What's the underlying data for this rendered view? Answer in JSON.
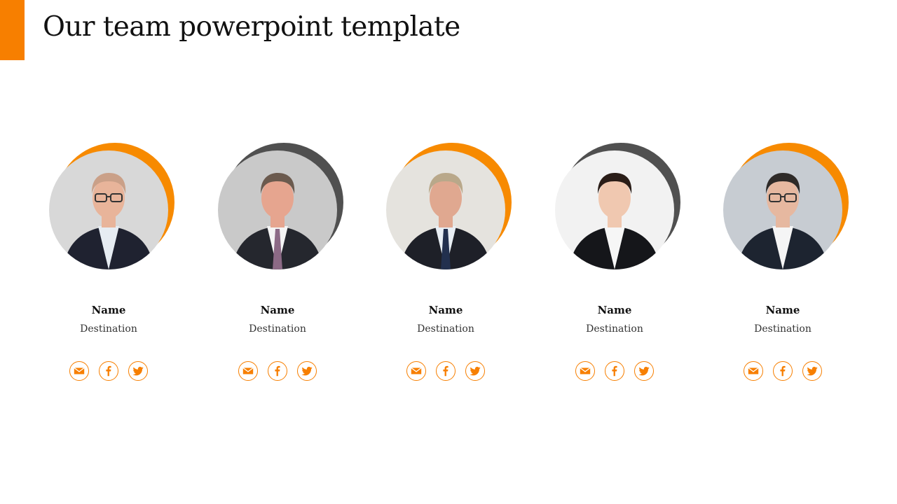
{
  "slide": {
    "title": "Our team powerpoint template",
    "accent_color": "#F77F00",
    "secondary_accent_color": "#505050"
  },
  "members": [
    {
      "name": "Name",
      "destination": "Destination",
      "ring_color": "#F78A00",
      "photo": {
        "bg": "#d8d8d8",
        "skin": "#e8b49a",
        "hair": "#caa088",
        "suit": "#1f2230",
        "shirt": "#e6ecf2",
        "tie": null,
        "glasses": true
      }
    },
    {
      "name": "Name",
      "destination": "Destination",
      "ring_color": "#505050",
      "photo": {
        "bg": "#c9c9c9",
        "skin": "#e6a58f",
        "hair": "#6b5a4e",
        "suit": "#25272e",
        "shirt": "#f4f4f4",
        "tie": "#8c6a86",
        "glasses": false
      }
    },
    {
      "name": "Name",
      "destination": "Destination",
      "ring_color": "#F78A00",
      "photo": {
        "bg": "#e5e3de",
        "skin": "#e0a890",
        "hair": "#b9a88a",
        "suit": "#1e2028",
        "shirt": "#e8eef4",
        "tie": "#22304e",
        "glasses": false
      }
    },
    {
      "name": "Name",
      "destination": "Destination",
      "ring_color": "#505050",
      "photo": {
        "bg": "#f2f2f2",
        "skin": "#f0c8b0",
        "hair": "#2a1d18",
        "suit": "#15161a",
        "shirt": "#f6f6f6",
        "tie": null,
        "glasses": false
      }
    },
    {
      "name": "Name",
      "destination": "Destination",
      "ring_color": "#F78A00",
      "photo": {
        "bg": "#c7ccd2",
        "skin": "#e6b8a0",
        "hair": "#2e2a28",
        "suit": "#1d2430",
        "shirt": "#f5f5f5",
        "tie": null,
        "glasses": true
      }
    }
  ],
  "social_icons": [
    "email-icon",
    "facebook-icon",
    "twitter-icon"
  ]
}
